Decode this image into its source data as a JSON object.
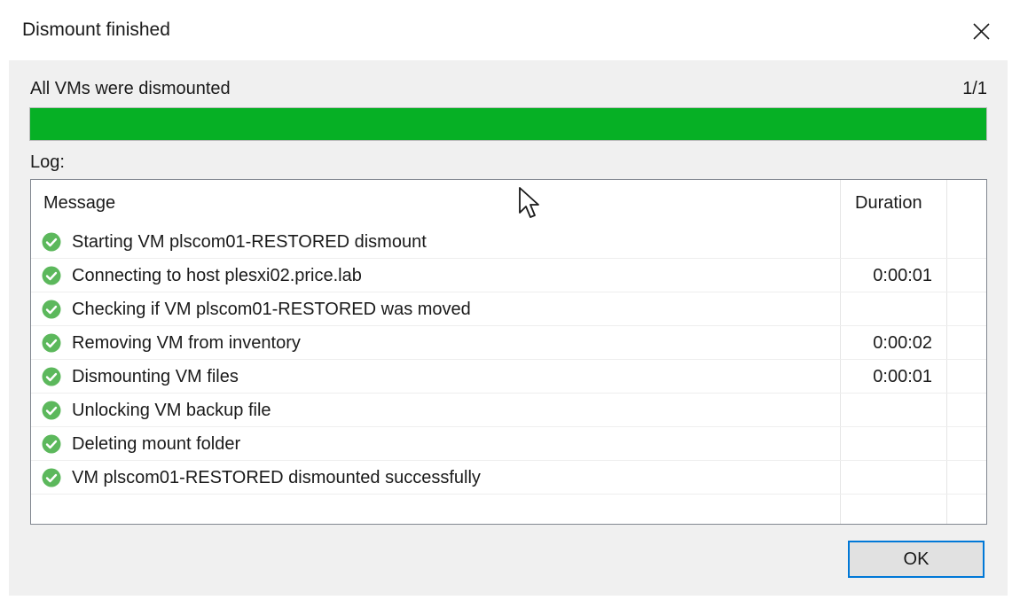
{
  "window": {
    "title": "Dismount finished",
    "close_icon": "close-icon"
  },
  "progress": {
    "status": "All VMs were dismounted",
    "count": "1/1",
    "percent": 100,
    "color": "#06b025"
  },
  "log": {
    "label": "Log:",
    "columns": {
      "message": "Message",
      "duration": "Duration"
    },
    "rows": [
      {
        "icon": "success-check-icon",
        "message": "Starting VM plscom01-RESTORED dismount",
        "duration": ""
      },
      {
        "icon": "success-check-icon",
        "message": "Connecting to host plesxi02.price.lab",
        "duration": "0:00:01"
      },
      {
        "icon": "success-check-icon",
        "message": "Checking if VM plscom01-RESTORED was moved",
        "duration": ""
      },
      {
        "icon": "success-check-icon",
        "message": "Removing VM from inventory",
        "duration": "0:00:02"
      },
      {
        "icon": "success-check-icon",
        "message": "Dismounting VM files",
        "duration": "0:00:01"
      },
      {
        "icon": "success-check-icon",
        "message": "Unlocking VM backup file",
        "duration": ""
      },
      {
        "icon": "success-check-icon",
        "message": "Deleting mount folder",
        "duration": ""
      },
      {
        "icon": "success-check-icon",
        "message": "VM plscom01-RESTORED dismounted successfully",
        "duration": ""
      }
    ]
  },
  "footer": {
    "ok_label": "OK"
  },
  "colors": {
    "accent": "#0078d7",
    "success": "#5cb85c"
  }
}
